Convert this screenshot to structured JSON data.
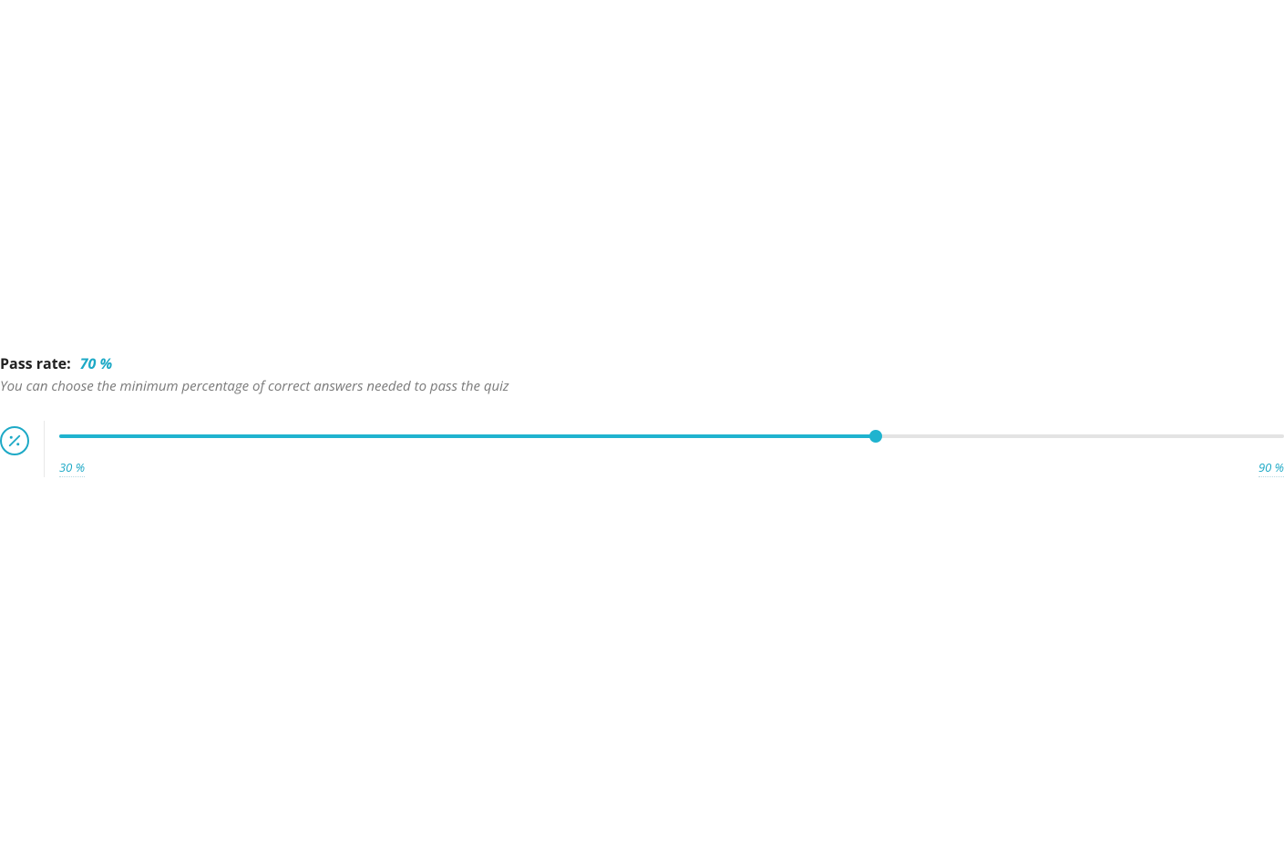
{
  "passRate": {
    "label": "Pass rate:",
    "value": "70 %",
    "description": "You can choose the minimum percentage of correct answers needed to pass the quiz"
  },
  "slider": {
    "min": 30,
    "max": 90,
    "current": 70,
    "minLabel": "30 %",
    "maxLabel": "90 %",
    "fillPercent": "66.6667%"
  },
  "colors": {
    "accent": "#1da9c6",
    "trackBg": "#e3e3e3",
    "trackFill": "#1fb3cf",
    "textMuted": "#7a7a7a",
    "text": "#222222"
  },
  "icon": {
    "name": "percent-icon"
  }
}
